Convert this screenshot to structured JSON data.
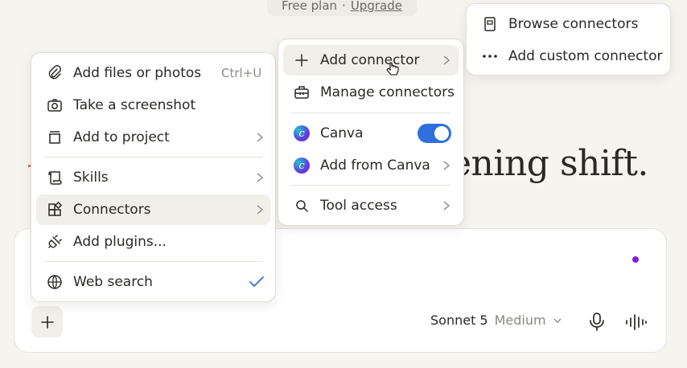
{
  "plan": {
    "text": "Free plan",
    "separator": "·",
    "link": "Upgrade"
  },
  "headline": "ening shift.",
  "composer": {
    "model_name": "Sonnet 5",
    "effort": "Medium",
    "plus_icon": "plus-icon",
    "mic_icon": "microphone-icon",
    "voice_icon": "voice-wave-icon"
  },
  "main_menu": {
    "items": [
      {
        "label": "Add files or photos",
        "shortcut": "Ctrl+U",
        "icon": "paperclip-icon"
      },
      {
        "label": "Take a screenshot",
        "icon": "camera-icon"
      },
      {
        "label": "Add to project",
        "icon": "project-box-icon",
        "submenu": true
      },
      {
        "label": "Skills",
        "icon": "scroll-icon",
        "submenu": true
      },
      {
        "label": "Connectors",
        "icon": "connectors-icon",
        "submenu": true,
        "highlighted": true
      },
      {
        "label": "Add plugins...",
        "icon": "plug-icon"
      },
      {
        "label": "Web search",
        "icon": "globe-icon",
        "checked": true
      }
    ]
  },
  "connectors_menu": {
    "items": [
      {
        "label": "Add connector",
        "icon": "plus-icon",
        "submenu": true,
        "highlighted": true
      },
      {
        "label": "Manage connectors",
        "icon": "toolbox-icon"
      },
      {
        "label": "Canva",
        "icon": "canva-logo-icon",
        "toggle_on": true
      },
      {
        "label": "Add from Canva",
        "icon": "canva-logo-icon",
        "submenu": true
      },
      {
        "label": "Tool access",
        "icon": "search-icon",
        "submenu": true
      }
    ]
  },
  "add_connector_menu": {
    "items": [
      {
        "label": "Browse connectors",
        "icon": "book-icon"
      },
      {
        "label": "Add custom connector",
        "icon": "ellipsis-icon"
      }
    ]
  },
  "colors": {
    "accent": "#2f6fde",
    "dot": "#7b20e0",
    "background": "#f6f4ef"
  }
}
